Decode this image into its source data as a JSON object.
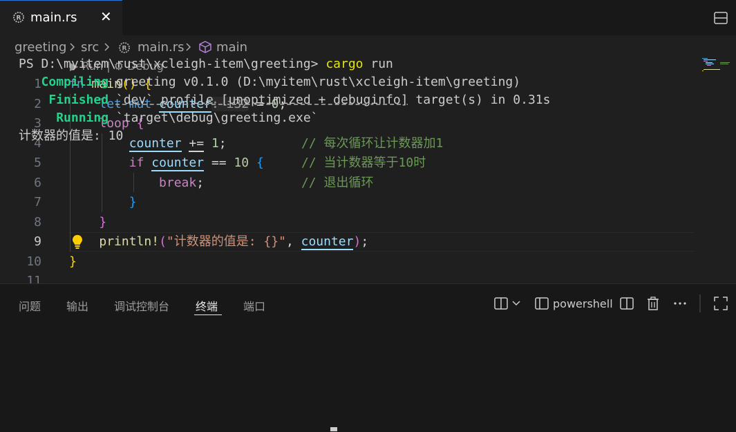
{
  "tab": {
    "filename": "main.rs",
    "close": "✕"
  },
  "breadcrumb": {
    "folder": "greeting",
    "sub": "src",
    "file": "main.rs",
    "symbol": "main"
  },
  "codelens": {
    "run": "Run",
    "sep": "|",
    "debug": "Debug"
  },
  "editor": {
    "line_numbers": [
      "1",
      "2",
      "3",
      "4",
      "5",
      "6",
      "7",
      "8",
      "9",
      "10",
      "11"
    ],
    "lines": {
      "l1": {
        "fn": "fn",
        "name": "main",
        "parens": "()",
        "brace": "{"
      },
      "l2": {
        "let": "let",
        "mut": "mut",
        "var": "counter",
        "hint": ": i32",
        "eq": " = ",
        "val": "0",
        "semi": ";"
      },
      "l3": {
        "loop": "loop",
        "brace": "{"
      },
      "l4": {
        "var": "counter",
        "op": "+=",
        "val": "1",
        "semi": ";",
        "comment": "// 每次循环让计数器加1"
      },
      "l5": {
        "if": "if",
        "var": "counter",
        "op": "==",
        "val": "10",
        "brace": "{",
        "comment": "// 当计数器等于10时"
      },
      "l6": {
        "brk": "break",
        "semi": ";",
        "comment": "// 退出循环"
      },
      "l7": {
        "brace": "}"
      },
      "l8": {
        "brace": "}"
      },
      "l9": {
        "macro": "println!",
        "open": "(",
        "str": "\"计数器的值是: {}\"",
        "comma": ", ",
        "var": "counter",
        "close": ")",
        "semi": ";"
      },
      "l10": {
        "brace": "}"
      }
    }
  },
  "panel": {
    "tabs": [
      "问题",
      "输出",
      "调试控制台",
      "终端",
      "端口"
    ],
    "active_tab": "终端",
    "shell": "powershell"
  },
  "terminal": {
    "prompt": "PS D:\\myitem\\rust\\xcleigh-item\\greeting> ",
    "cmd": "cargo",
    "args": " run",
    "compiling_label": "Compiling",
    "compiling_text": " greeting v0.1.0 (D:\\myitem\\rust\\xcleigh-item\\greeting)",
    "finished_label": "Finished",
    "finished_part1": "`dev` profile [unoptimized + debuginfo]",
    "finished_part2": " target(s) in 0.31s",
    "running_label": "Running",
    "running_text": "`target\\debug\\greeting.exe`",
    "output": "计数器的值是: 10"
  },
  "colors": {
    "accent": "#2b79d7",
    "keyword": "#569cd6",
    "comment": "#6a9955",
    "green": "#23d18b"
  }
}
